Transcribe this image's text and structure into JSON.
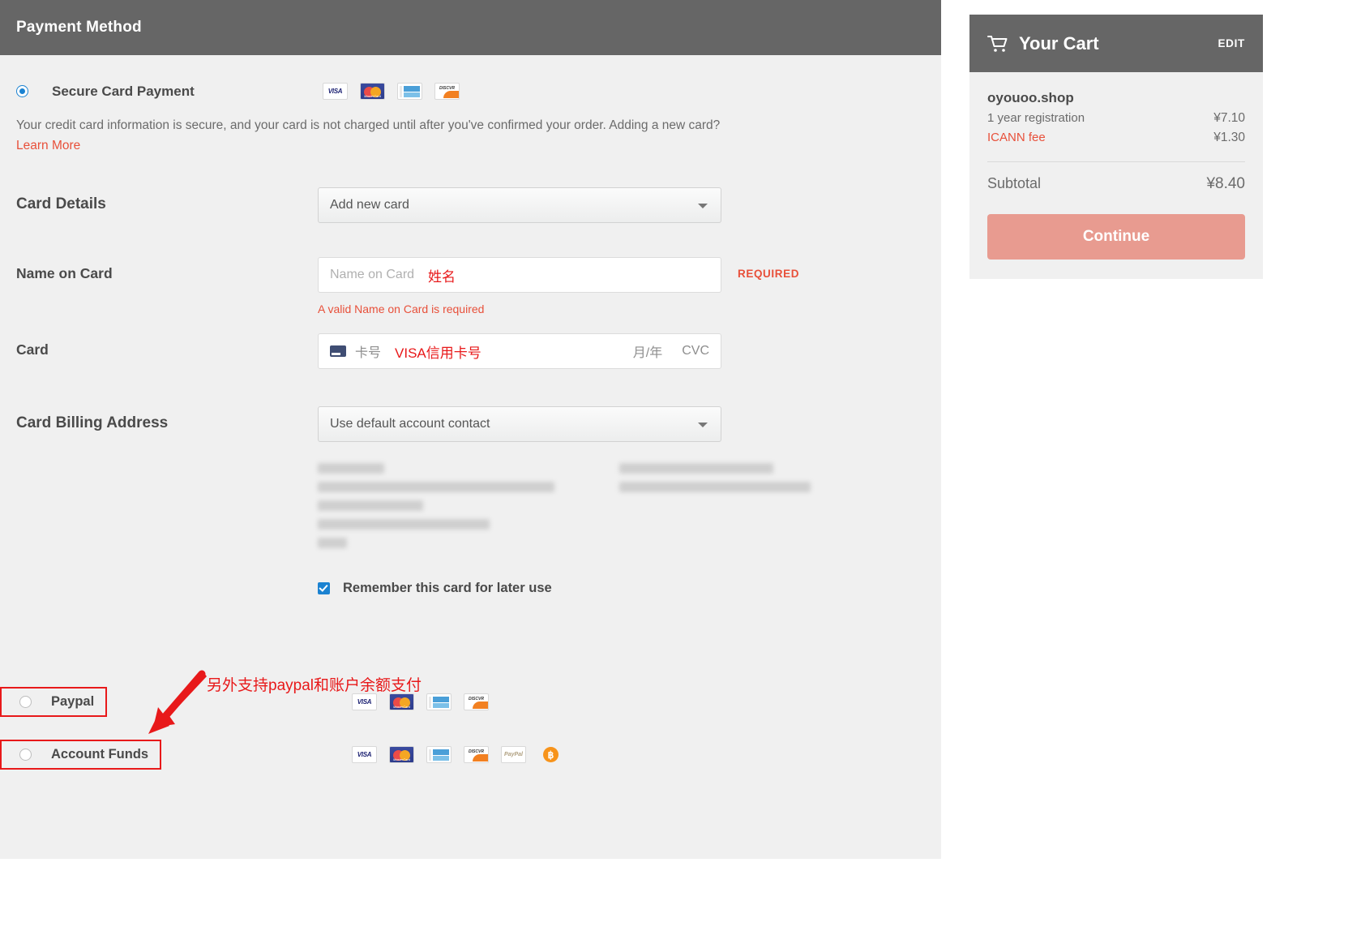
{
  "panel": {
    "header_title": "Payment Method",
    "secure_option": {
      "label": "Secure Card Payment",
      "selected": true,
      "description": "Your credit card information is secure, and your card is not charged until after you've confirmed your order. Adding a new card?",
      "learn_more": "Learn More",
      "accepted_cards": [
        "visa-icon",
        "mastercard-icon",
        "amex-icon",
        "discover-icon"
      ]
    },
    "card_details": {
      "label": "Card Details",
      "select_value": "Add new card"
    },
    "name_on_card": {
      "label": "Name on Card",
      "placeholder": "Name on Card",
      "annotation": "姓名",
      "required_tag": "REQUIRED",
      "error": "A valid Name on Card is required"
    },
    "card": {
      "label": "Card",
      "number_placeholder": "卡号",
      "annotation": "VISA信用卡号",
      "expiry_placeholder": "月/年",
      "cvc_placeholder": "CVC",
      "icon": "credit-card-icon"
    },
    "billing_address": {
      "label": "Card Billing Address",
      "select_value": "Use default account contact"
    },
    "remember": {
      "label": "Remember this card for later use",
      "checked": true
    },
    "annotation_alt": "另外支持paypal和账户余额支付",
    "alt_methods": [
      {
        "label": "Paypal",
        "selected": false,
        "cards": [
          "visa-icon",
          "mastercard-icon",
          "amex-icon",
          "discover-icon"
        ]
      },
      {
        "label": "Account Funds",
        "selected": false,
        "cards": [
          "visa-icon",
          "mastercard-icon",
          "amex-icon",
          "discover-icon",
          "paypal-icon",
          "bitcoin-icon"
        ]
      }
    ]
  },
  "cart": {
    "title": "Your Cart",
    "edit": "EDIT",
    "domain": "oyouoo.shop",
    "registration_label": "1 year registration",
    "registration_price": "¥7.10",
    "icann_label": "ICANN fee",
    "icann_price": "¥1.30",
    "subtotal_label": "Subtotal",
    "subtotal_price": "¥8.40",
    "continue_label": "Continue"
  },
  "colors": {
    "header_gray": "#666666",
    "panel_bg": "#f0f0f0",
    "accent_red": "#e8503a",
    "annotation_red": "#e8191a",
    "continue_btn": "#e89b90",
    "radio_blue": "#1b82d1"
  }
}
